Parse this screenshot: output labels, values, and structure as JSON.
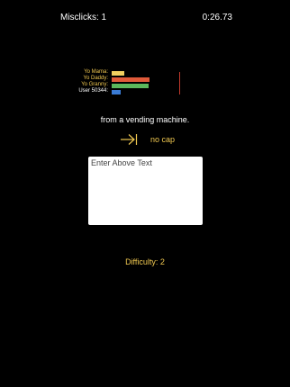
{
  "header": {
    "misclicks": "Misclicks: 1",
    "timer": "0:26.73"
  },
  "race": {
    "racers": [
      {
        "name": "Yo Mama:",
        "name_color": "#f0c850",
        "progress": 0.19,
        "bar_color": "#f0d060"
      },
      {
        "name": "Yo Daddy:",
        "name_color": "#f0c850",
        "progress": 0.56,
        "bar_color": "#e05a3a"
      },
      {
        "name": "Yo Granny:",
        "name_color": "#f0c850",
        "progress": 0.54,
        "bar_color": "#5cb85c"
      },
      {
        "name": "User 50344:",
        "name_color": "#ffffff",
        "progress": 0.13,
        "bar_color": "#3a7bd5"
      }
    ],
    "finish_color": "#c0392b"
  },
  "prompt": {
    "text": "from a vending machine."
  },
  "mode": {
    "icon": "tab-arrow-icon",
    "label": "no cap"
  },
  "answer": {
    "placeholder": "Enter Above Text",
    "value": ""
  },
  "footer": {
    "difficulty": "Difficulty: 2"
  },
  "colors": {
    "accent": "#f0c850",
    "background": "#000000"
  }
}
